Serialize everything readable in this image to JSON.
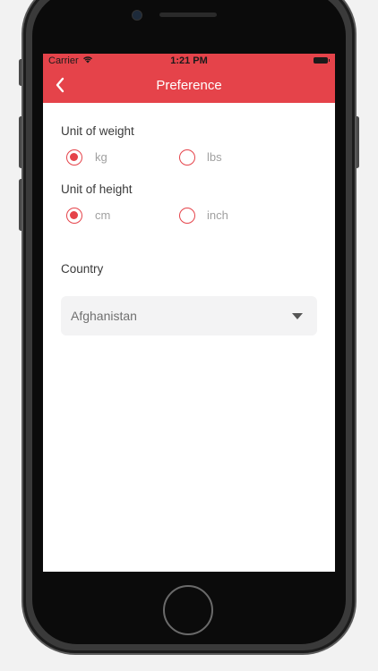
{
  "status_bar": {
    "carrier": "Carrier",
    "time": "1:21 PM"
  },
  "nav": {
    "title": "Preference"
  },
  "weight": {
    "label": "Unit of weight",
    "options": [
      {
        "label": "kg",
        "selected": true
      },
      {
        "label": "lbs",
        "selected": false
      }
    ]
  },
  "height": {
    "label": "Unit of height",
    "options": [
      {
        "label": "cm",
        "selected": true
      },
      {
        "label": "inch",
        "selected": false
      }
    ]
  },
  "country": {
    "label": "Country",
    "selected": "Afghanistan"
  },
  "colors": {
    "accent": "#e5434a"
  }
}
